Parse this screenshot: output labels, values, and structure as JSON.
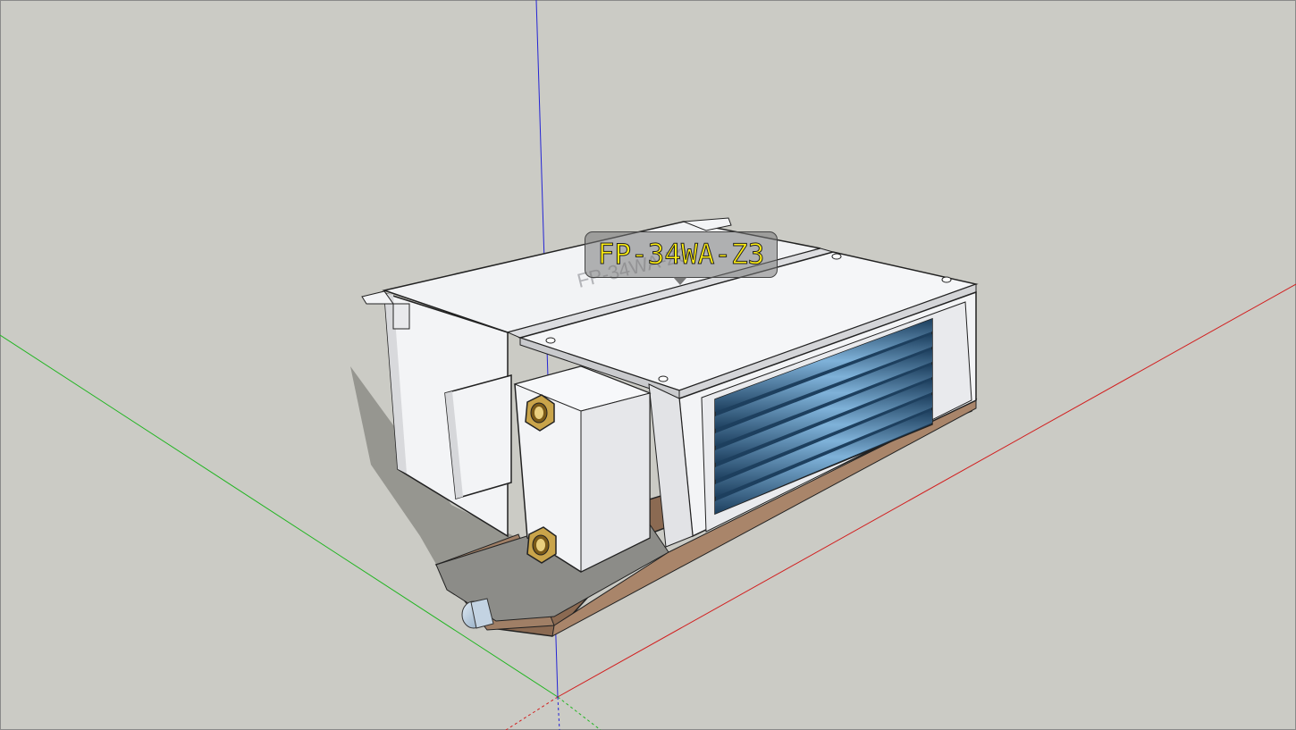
{
  "viewport": {
    "background_color": "#cbcbc5"
  },
  "axes": {
    "red_axis_color": "#d22020",
    "green_axis_color": "#20b020",
    "blue_axis_color": "#2020d0"
  },
  "model": {
    "label": "FP-34WA-Z3",
    "label_color": "#ffee10",
    "embossed_text": "FP-34WA-Z3",
    "coil_color": "#3e6f98",
    "body_color": "#f1f2f4",
    "drain_pan_color": "#8a6a52"
  }
}
